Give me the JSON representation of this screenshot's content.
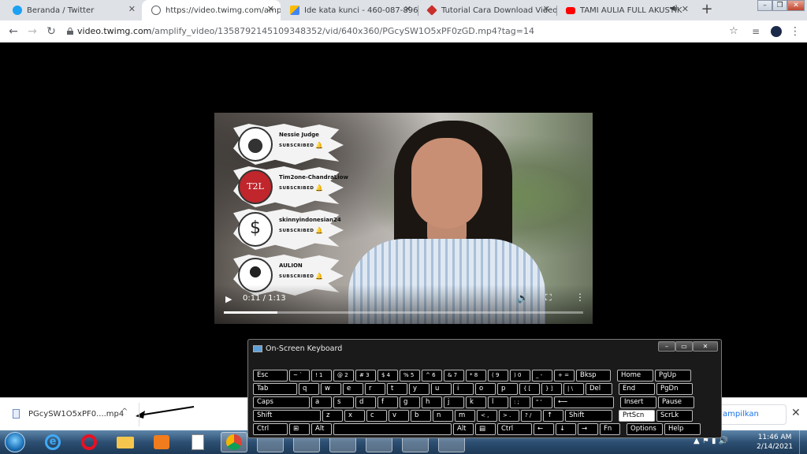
{
  "browser": {
    "tabs": [
      {
        "title": "Beranda / Twitter",
        "icon": "twitter-icon",
        "color": "#1da1f2"
      },
      {
        "title": "https://video.twimg.com/amplify_",
        "icon": "globe-icon",
        "color": "#5f6368",
        "active": true
      },
      {
        "title": "Ide kata kunci - 460-087-8966 -",
        "icon": "google-ads-icon",
        "color": "#fbbc04"
      },
      {
        "title": "Tutorial Cara Download Video T",
        "icon": "site-icon",
        "color": "#c9302c"
      },
      {
        "title": "TAMI AULIA FULL AKUSTIK",
        "icon": "youtube-icon",
        "color": "#ff0000"
      }
    ],
    "tab_close": "✕",
    "new_tab": "+",
    "window_buttons": [
      "–",
      "❐",
      "✕"
    ],
    "nav": {
      "back": "←",
      "forward": "→",
      "reload": "↻"
    },
    "url_domain": "video.twimg.com",
    "url_path": "/amplify_video/1358792145109348352/vid/640x360/PGcySW1O5xPF0zGD.mp4?tag=14",
    "toolbar_icons": [
      "star-icon",
      "media-icon",
      "profile-icon",
      "menu-icon"
    ]
  },
  "video": {
    "subscriptions": [
      {
        "name": "Nessie Judge",
        "status": "SUBSCRIBED"
      },
      {
        "name": "Tim2one-ChandraLiow",
        "status": "SUBSCRIBED",
        "avatar_text": "T2L"
      },
      {
        "name": "skinnyindonesian24",
        "status": "SUBSCRIBED"
      },
      {
        "name": "AULION",
        "status": "SUBSCRIBED"
      }
    ],
    "time": "0:11 / 1:13",
    "progress": 0.15
  },
  "download_shelf": {
    "filename": "PGcySW1O5xPF0....mp4",
    "caret": "^",
    "show_all": "ampilkan semua",
    "close": "✕"
  },
  "keyboard": {
    "title": "On-Screen Keyboard",
    "window_buttons": [
      "–",
      "▭",
      "✕"
    ],
    "rows": [
      [
        "Esc",
        "~ `",
        "! 1",
        "@ 2",
        "# 3",
        "$ 4",
        "% 5",
        "^ 6",
        "& 7",
        "* 8",
        "( 9",
        ") 0",
        "_ -",
        "+ =",
        "Bksp",
        "Home",
        "PgUp"
      ],
      [
        "Tab",
        "q",
        "w",
        "e",
        "r",
        "t",
        "y",
        "u",
        "i",
        "o",
        "p",
        "{ [",
        "} ]",
        "| \\",
        "Del",
        "End",
        "PgDn"
      ],
      [
        "Caps",
        "a",
        "s",
        "d",
        "f",
        "g",
        "h",
        "j",
        "k",
        "l",
        ": ;",
        "\" '",
        "⟵",
        "Insert",
        "Pause"
      ],
      [
        "Shift",
        "z",
        "x",
        "c",
        "v",
        "b",
        "n",
        "m",
        "< ,",
        "> .",
        "? /",
        "↑",
        "Shift",
        "PrtScn",
        "ScrLk"
      ],
      [
        "Ctrl",
        "⊞",
        "Alt",
        "",
        "Alt",
        "▤",
        "Ctrl",
        "←",
        "↓",
        "→",
        "Fn",
        "Options",
        "Help"
      ]
    ]
  },
  "taskbar": {
    "apps": [
      "internet-explorer-icon",
      "opera-icon",
      "file-explorer-icon",
      "media-player-icon",
      "document-icon",
      "chrome-icon",
      "app-icon",
      "app-icon",
      "app-icon",
      "app-icon",
      "app-icon",
      "app-icon"
    ],
    "time": "11:46 AM",
    "date": "2/14/2021"
  }
}
